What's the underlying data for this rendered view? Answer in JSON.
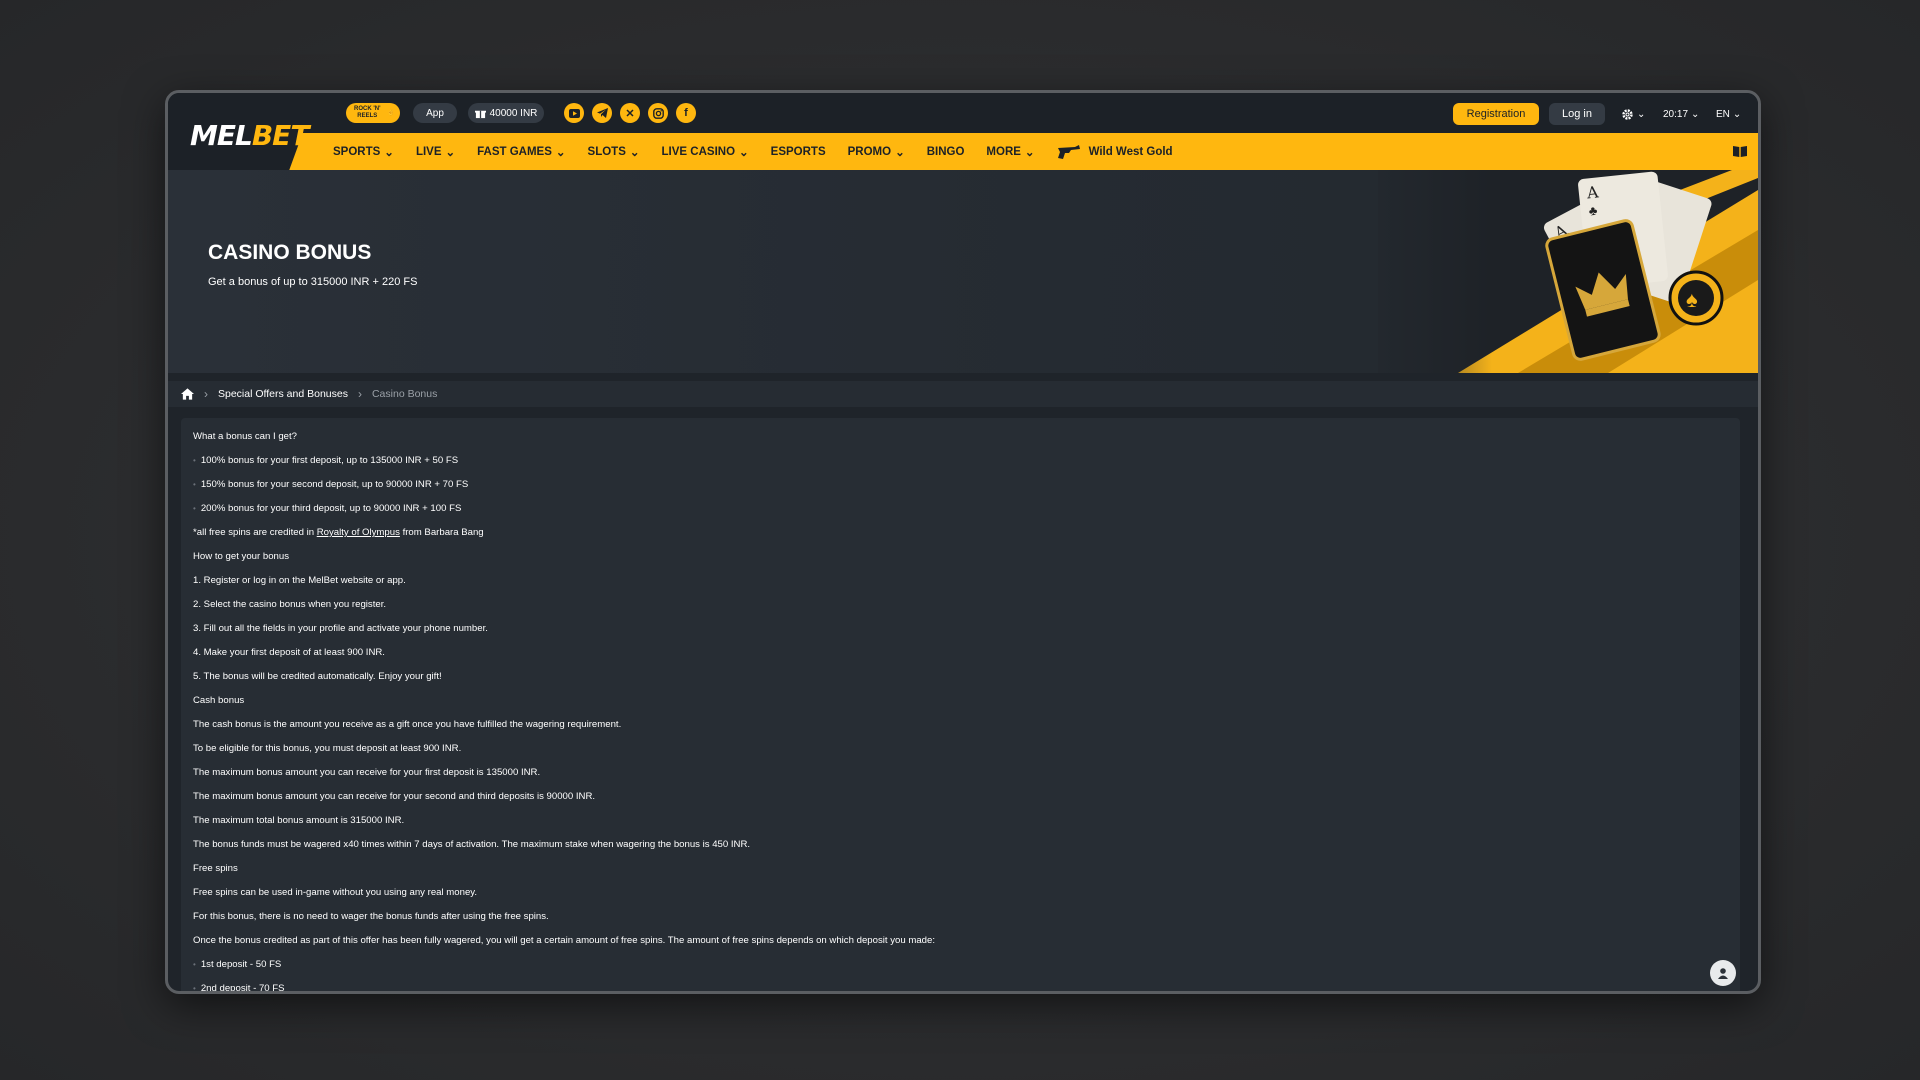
{
  "header": {
    "logo": {
      "part1": "MEL",
      "part2": "BET"
    },
    "promo_badge": "ROCK 'N' REELS",
    "app_label": "App",
    "bonus_label": "40000 INR",
    "socials": [
      "youtube-icon",
      "telegram-icon",
      "x-icon",
      "instagram-icon",
      "facebook-icon"
    ],
    "registration_label": "Registration",
    "login_label": "Log in",
    "time": "20:17",
    "language": "EN"
  },
  "nav": {
    "items": [
      {
        "label": "SPORTS",
        "dropdown": true
      },
      {
        "label": "LIVE",
        "dropdown": true
      },
      {
        "label": "FAST GAMES",
        "dropdown": true
      },
      {
        "label": "SLOTS",
        "dropdown": true
      },
      {
        "label": "LIVE CASINO",
        "dropdown": true
      },
      {
        "label": "ESPORTS",
        "dropdown": false
      },
      {
        "label": "PROMO",
        "dropdown": true
      },
      {
        "label": "BINGO",
        "dropdown": false
      },
      {
        "label": "MORE",
        "dropdown": true
      }
    ],
    "special": "Wild West Gold"
  },
  "hero": {
    "title": "CASINO BONUS",
    "subtitle": "Get a bonus of up to 315000 INR + 220 FS"
  },
  "breadcrumb": {
    "link": "Special Offers and Bonuses",
    "current": "Casino Bonus"
  },
  "content": {
    "lines": [
      {
        "text": "What a bonus can I get?",
        "bullet": false
      },
      {
        "text": "100% bonus for your first deposit, up to 135000 INR + 50 FS",
        "bullet": true
      },
      {
        "text": "150% bonus for your second deposit, up to 90000 INR + 70 FS",
        "bullet": true
      },
      {
        "text": "200% bonus for your third deposit, up to 90000 INR + 100 FS",
        "bullet": true
      },
      {
        "text": "*all free spins are credited in ",
        "link": "Royalty of Olympus",
        "after": " from Barbara Bang",
        "bullet": false
      },
      {
        "text": "How to get your bonus",
        "bullet": false
      },
      {
        "text": "1. Register or log in on the MelBet website or app.",
        "bullet": false
      },
      {
        "text": "2. Select the casino bonus when you register.",
        "bullet": false
      },
      {
        "text": "3. Fill out all the fields in your profile and activate your phone number.",
        "bullet": false
      },
      {
        "text": "4. Make your first deposit of at least 900 INR.",
        "bullet": false
      },
      {
        "text": "5. The bonus will be credited automatically. Enjoy your gift!",
        "bullet": false
      },
      {
        "text": "Cash bonus",
        "bullet": false
      },
      {
        "text": "The cash bonus is the amount you receive as a gift once you have fulfilled the wagering requirement.",
        "bullet": false
      },
      {
        "text": "To be eligible for this bonus, you must deposit at least 900 INR.",
        "bullet": false
      },
      {
        "text": "The maximum bonus amount you can receive for your first deposit is 135000 INR.",
        "bullet": false
      },
      {
        "text": "The maximum bonus amount you can receive for your second and third deposits is 90000 INR.",
        "bullet": false
      },
      {
        "text": "The maximum total bonus amount is 315000 INR.",
        "bullet": false
      },
      {
        "text": "The bonus funds must be wagered x40 times within 7 days of activation. The maximum stake when wagering the bonus is 450 INR.",
        "bullet": false
      },
      {
        "text": "Free spins",
        "bullet": false
      },
      {
        "text": "Free spins can be used in-game without you using any real money.",
        "bullet": false
      },
      {
        "text": "For this bonus, there is no need to wager the bonus funds after using the free spins.",
        "bullet": false
      },
      {
        "text": "Once the bonus credited as part of this offer has been fully wagered, you will get a certain amount of free spins. The amount of free spins depends on which deposit you made:",
        "bullet": false
      },
      {
        "text": "1st deposit - 50 FS",
        "bullet": true
      },
      {
        "text": "2nd deposit - 70 FS",
        "bullet": true
      }
    ]
  },
  "colors": {
    "accent": "#ffb70f",
    "header_bg": "#1c2127",
    "content_bg": "#272d34"
  }
}
